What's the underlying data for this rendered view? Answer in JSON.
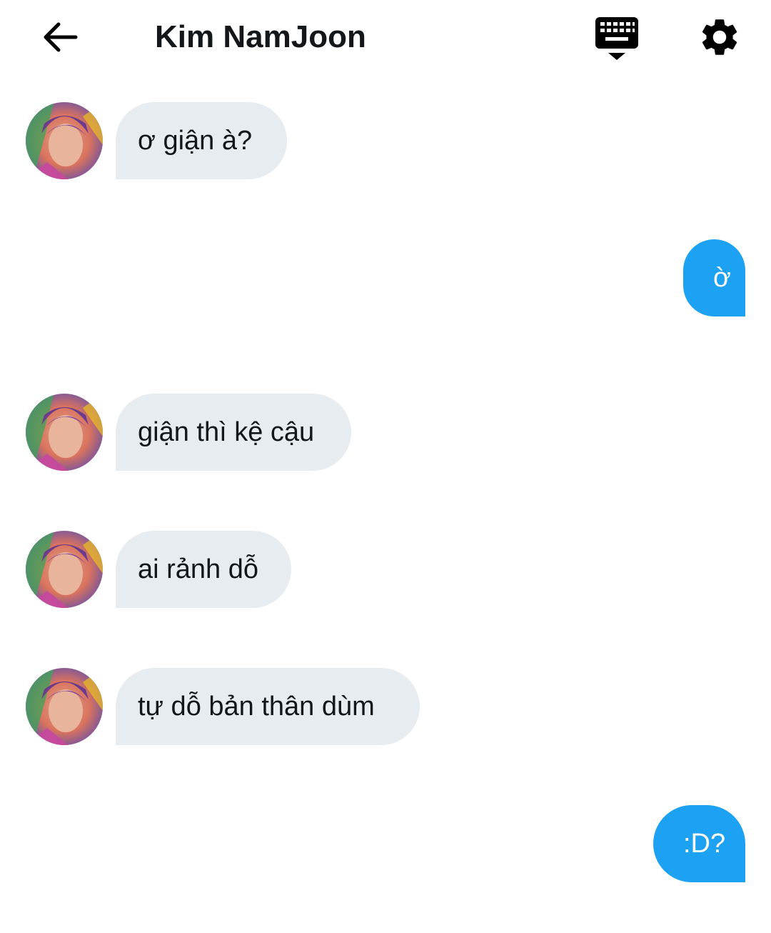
{
  "header": {
    "title": "Kim NamJoon",
    "back_icon": "arrow-left-icon",
    "keyboard_icon": "keyboard-hide-icon",
    "settings_icon": "gear-icon"
  },
  "colors": {
    "incoming_bubble": "#e6ecf0",
    "outgoing_bubble": "#1da1f2",
    "text": "#14171a"
  },
  "messages": [
    {
      "direction": "incoming",
      "text": "ơ giận à?"
    },
    {
      "direction": "outgoing",
      "text": "ờ"
    },
    {
      "direction": "incoming",
      "text": "giận thì kệ cậu"
    },
    {
      "direction": "incoming",
      "text": "ai rảnh dỗ"
    },
    {
      "direction": "incoming",
      "text": "tự dỗ bản thân dùm"
    },
    {
      "direction": "outgoing",
      "text": ":D?"
    }
  ]
}
